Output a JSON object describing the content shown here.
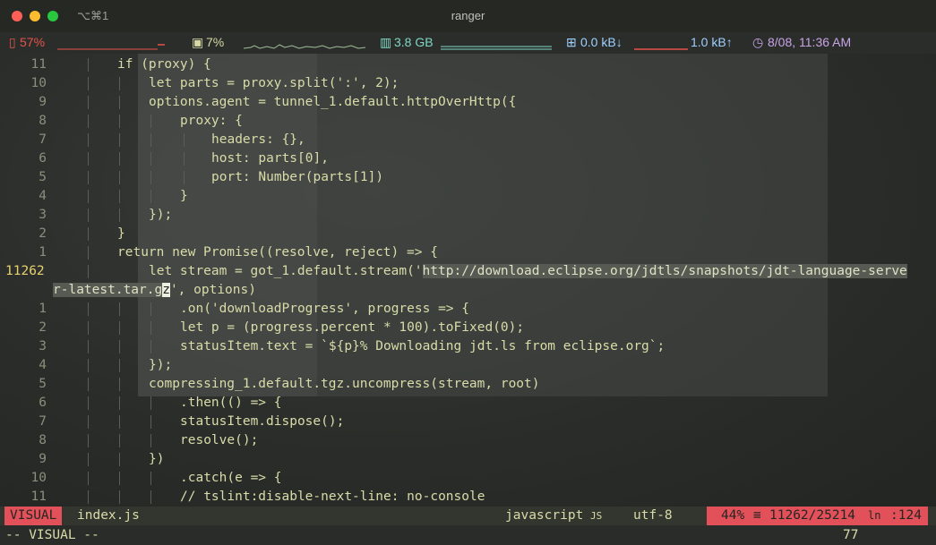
{
  "window": {
    "title": "ranger",
    "shortcut": "⌥⌘1"
  },
  "sysbar": {
    "battery": "57%",
    "cpu": "7%",
    "memory": "3.8 GB",
    "net_down": "0.0 kB↓",
    "net_up": "1.0 kB↑",
    "datetime": "8/08, 11:36 AM",
    "colors": {
      "battery": "#e5534b",
      "cpu": "#d6d9a6",
      "memory": "#7fd7c4",
      "net": "#9ed0ff",
      "clock": "#c9a4e8"
    }
  },
  "editor": {
    "lines": [
      {
        "num": "11",
        "indent": 1,
        "text": "if (proxy) {"
      },
      {
        "num": "10",
        "indent": 2,
        "text": "let parts = proxy.split(':', 2);"
      },
      {
        "num": "9",
        "indent": 2,
        "text": "options.agent = tunnel_1.default.httpOverHttp({"
      },
      {
        "num": "8",
        "indent": 3,
        "text": "proxy: {"
      },
      {
        "num": "7",
        "indent": 4,
        "text": "headers: {},"
      },
      {
        "num": "6",
        "indent": 4,
        "text": "host: parts[0],"
      },
      {
        "num": "5",
        "indent": 4,
        "text": "port: Number(parts[1])"
      },
      {
        "num": "4",
        "indent": 3,
        "text": "}"
      },
      {
        "num": "3",
        "indent": 2,
        "text": "});"
      },
      {
        "num": "2",
        "indent": 1,
        "text": "}"
      },
      {
        "num": "1",
        "indent": 1,
        "text": "return new Promise((resolve, reject) => {"
      },
      {
        "num": "11262",
        "current": true,
        "indent": 2,
        "pre": "let stream = got_1.default.stream('",
        "sel": "http://download.eclipse.org/jdtls/snapshots/jdt-language-serve"
      },
      {
        "num": "",
        "wrap": true,
        "sel": "r-latest.tar.g",
        "cursor": "z",
        "post": "', options)"
      },
      {
        "num": "1",
        "indent": 3,
        "text": ".on('downloadProgress', progress => {"
      },
      {
        "num": "2",
        "indent": 3,
        "text": "let p = (progress.percent * 100).toFixed(0);"
      },
      {
        "num": "3",
        "indent": 3,
        "text": "statusItem.text = `${p}% Downloading jdt.ls from eclipse.org`;"
      },
      {
        "num": "4",
        "indent": 2,
        "text": "});"
      },
      {
        "num": "5",
        "indent": 2,
        "text": "compressing_1.default.tgz.uncompress(stream, root)"
      },
      {
        "num": "6",
        "indent": 3,
        "text": ".then(() => {"
      },
      {
        "num": "7",
        "indent": 3,
        "text": "statusItem.dispose();"
      },
      {
        "num": "8",
        "indent": 3,
        "text": "resolve();"
      },
      {
        "num": "9",
        "indent": 2,
        "text": "})"
      },
      {
        "num": "10",
        "indent": 3,
        "text": ".catch(e => {"
      },
      {
        "num": "11",
        "indent": 3,
        "text": "// tslint:disable-next-line: no-console"
      }
    ]
  },
  "statusline": {
    "mode": "VISUAL",
    "filename": "index.js",
    "filetype": "javascript",
    "filetype_icon": "JS",
    "encoding": "utf-8",
    "percent": "44%",
    "position": "11262/25214",
    "ln": "ln",
    "col": ":124",
    "accent": "#e2505a"
  },
  "cmdline": {
    "text": "-- VISUAL --",
    "count": "77"
  }
}
